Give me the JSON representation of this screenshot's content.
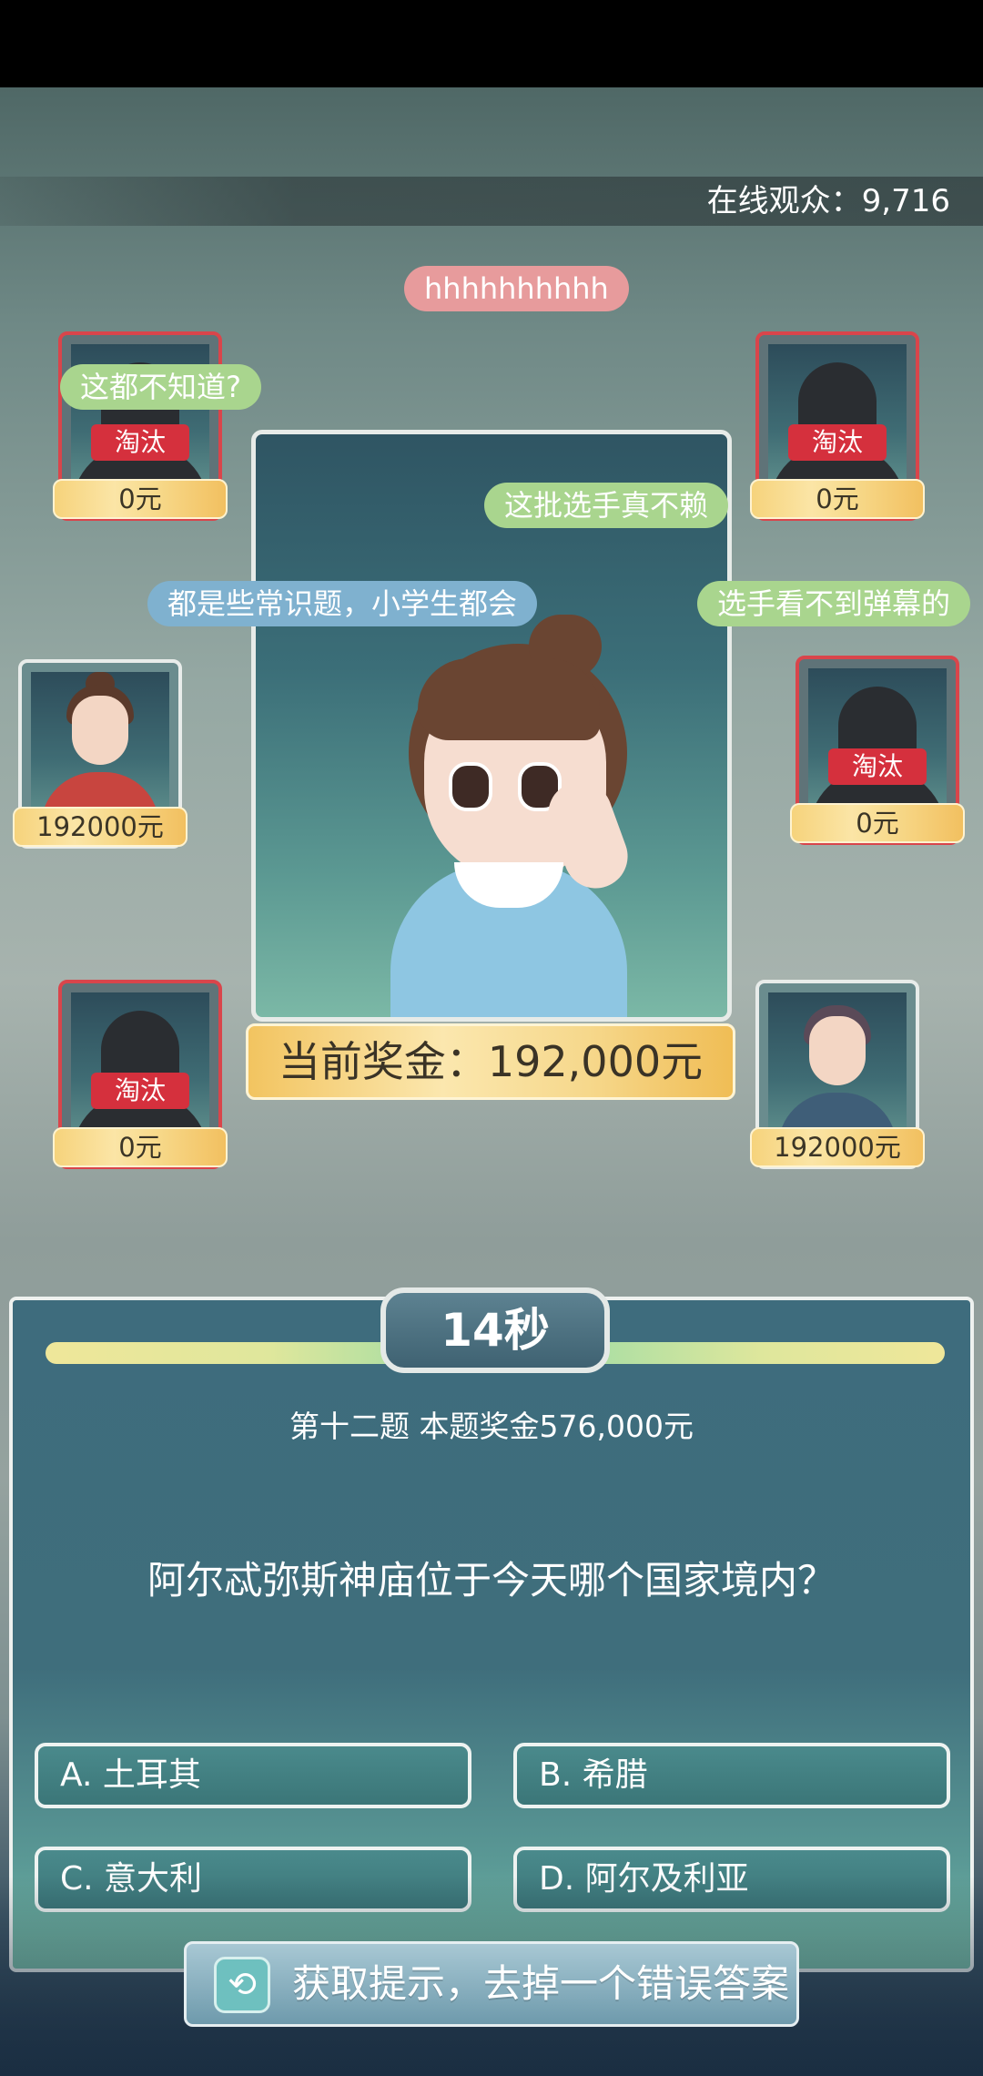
{
  "online": {
    "label": "在线观众：9,716"
  },
  "danmaku": [
    {
      "text": "hhhhhhhhhh"
    },
    {
      "text": "这都不知道?"
    },
    {
      "text": "这批选手真不赖"
    },
    {
      "text": "都是些常识题，小学生都会"
    },
    {
      "text": "选手看不到弹幕的"
    }
  ],
  "players": [
    {
      "status": "淘汰",
      "money": "0元"
    },
    {
      "status": "淘汰",
      "money": "0元"
    },
    {
      "status": "",
      "money": "192000元"
    },
    {
      "status": "淘汰",
      "money": "0元"
    },
    {
      "status": "淘汰",
      "money": "0元"
    },
    {
      "status": "",
      "money": "192000元"
    }
  ],
  "host": {
    "prize_label": "当前奖金：192,000元"
  },
  "question": {
    "timer": "14秒",
    "meta": "第十二题 本题奖金576,000元",
    "text": "阿尔忒弥斯神庙位于今天哪个国家境内？",
    "timer_fraction": 1.0
  },
  "answers": [
    {
      "label": "A. 土耳其"
    },
    {
      "label": "B. 希腊"
    },
    {
      "label": "C. 意大利"
    },
    {
      "label": "D. 阿尔及利亚"
    }
  ],
  "hint": {
    "label": "获取提示，去掉一个错误答案",
    "icon": "play-rewind-icon"
  },
  "colors": {
    "out_border": "#d9454b",
    "money_gold": "#f6d37c",
    "panel": "#3e6c7d"
  }
}
